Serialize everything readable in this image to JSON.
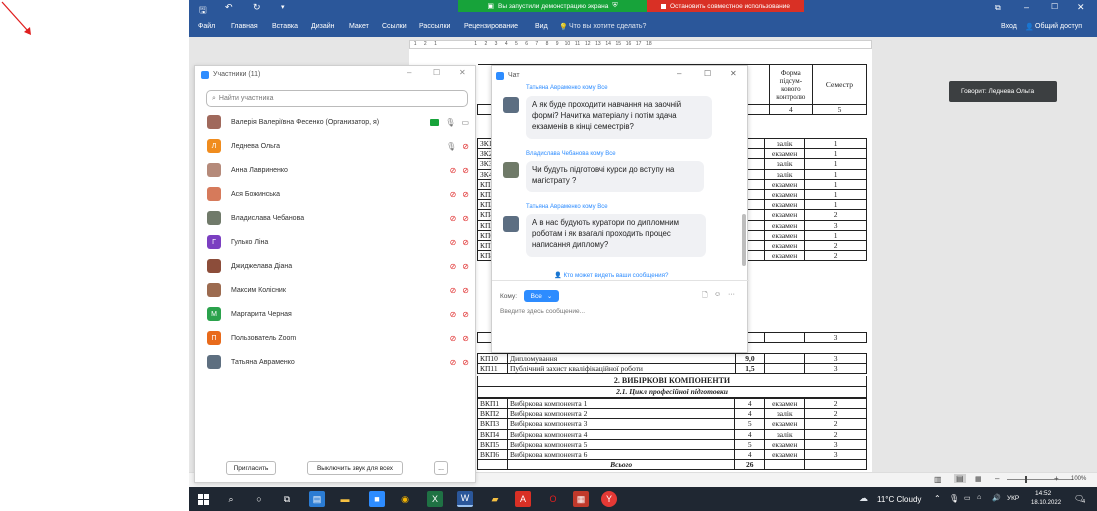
{
  "share_bar": {
    "started_text": "Вы запустили демонстрацию экрана",
    "stop_text": "Остановить совместное использование"
  },
  "word": {
    "menu": [
      "Файл",
      "Главная",
      "Вставка",
      "Дизайн",
      "Макет",
      "Ссылки",
      "Рассылки",
      "Рецензирование",
      "Вид"
    ],
    "tell_me": "Что вы хотите сделать?",
    "login": "Вход",
    "share": "Общий доступ",
    "ruler_marks": [
      "1",
      "2",
      "1",
      "1",
      "2",
      "3",
      "4",
      "5",
      "6",
      "7",
      "8",
      "9",
      "10",
      "11",
      "12",
      "13",
      "14",
      "15",
      "16",
      "17",
      "18"
    ],
    "status_zoom": "100%"
  },
  "tooltip": {
    "speaker": "Говорит: Леднева Ольга"
  },
  "participants": {
    "title": "Участники (11)",
    "search_placeholder": "Найти участника",
    "list": [
      {
        "name": "Валерія Валеріївна Фесенко (Организатор, я)",
        "avatar": "",
        "color": "#a0695c",
        "host": true
      },
      {
        "name": "Леднева Ольга",
        "avatar": "Л",
        "color": "#f08c1e"
      },
      {
        "name": "Анна Лавриненко",
        "avatar": "",
        "color": "#b58a7a"
      },
      {
        "name": "Ася Божинська",
        "avatar": "",
        "color": "#d67a5b"
      },
      {
        "name": "Владислава Чебанова",
        "avatar": "",
        "color": "#707a6a"
      },
      {
        "name": "Гулько Ліна",
        "avatar": "Г",
        "color": "#7b3fc1"
      },
      {
        "name": "Джиджелава Діана",
        "avatar": "",
        "color": "#8c4d3a"
      },
      {
        "name": "Максим Колісник",
        "avatar": "",
        "color": "#9c6b50"
      },
      {
        "name": "Маргарита Черная",
        "avatar": "М",
        "color": "#2ba24c"
      },
      {
        "name": "Пользователь Zoom",
        "avatar": "П",
        "color": "#e86a1b"
      },
      {
        "name": "Татьяна Авраменко",
        "avatar": "",
        "color": "#5e6f80"
      }
    ],
    "invite": "Пригласить",
    "mute_all": "Выключить звук для всех",
    "more": "..."
  },
  "chat": {
    "title": "Чат",
    "messages": [
      {
        "sender": "Татьяна Авраменко кому Все",
        "lines": [
          "А як буде проходити навчання на заочній",
          "формі? Начитка матеріалу і потім  здача",
          "екзаменів в кінці семестрів?"
        ]
      },
      {
        "sender": "Владислава Чебанова кому Все",
        "lines": [
          "Чи будуть підготовчі курси до вступу на",
          "магістрату ?"
        ]
      },
      {
        "sender": "Татьяна Авраменко кому Все",
        "lines": [
          "А в нас будують куратори по дипломним",
          "роботам і як взагалі проходить процес",
          "написання диплому?"
        ]
      }
    ],
    "who_can_see": "Кто может видеть ваши сообщения?",
    "to_label": "Кому:",
    "to_value": "Все",
    "input_placeholder": "Введите здесь сообщение..."
  },
  "doc": {
    "header": {
      "form": "Форма підсум-кового контролю",
      "semester": "Семестр",
      "num4": "4",
      "num5": "5",
      "num1": "1"
    },
    "rows_upper": [
      {
        "code": "ЗК1",
        "form": "залік",
        "sem": "1"
      },
      {
        "code": "ЗК2",
        "form": "екзамен",
        "sem": "1"
      },
      {
        "code": "ЗК3",
        "form": "залік",
        "sem": "1"
      },
      {
        "code": "ЗК4",
        "form": "залік",
        "sem": "1"
      },
      {
        "code": "КП1",
        "form": "екзамен",
        "sem": "1"
      },
      {
        "code": "КП2",
        "form": "екзамен",
        "sem": "1"
      },
      {
        "code": "КП3",
        "form": "екзамен",
        "sem": "1"
      },
      {
        "code": "КП4",
        "form": "екзамен",
        "sem": "2"
      },
      {
        "code": "КП5",
        "form": "екзамен",
        "sem": "3"
      },
      {
        "code": "КП6",
        "form": "екзамен",
        "sem": "1"
      },
      {
        "code": "КП7",
        "form": "екзамен",
        "sem": "2"
      },
      {
        "code": "КП8",
        "form": "екзамен",
        "sem": "2"
      }
    ],
    "block_sem": "3",
    "diploma": [
      {
        "code": "КП10",
        "name": "Дипломування",
        "credits": "9,0",
        "sem": "3"
      },
      {
        "code": "КП11",
        "name": "Публічний захист кваліфікаційної роботи",
        "credits": "1,5",
        "sem": "3"
      }
    ],
    "section_title": "2.  ВИБІРКОВІ КОМПОНЕНТИ",
    "subsection_title": "2.1. Цикл професійної підготовки",
    "elective": [
      {
        "code": "ВКП1",
        "name": "Вибіркова компонента 1",
        "credits": "4",
        "form": "екзамен",
        "sem": "2"
      },
      {
        "code": "ВКП2",
        "name": "Вибіркова компонента 2",
        "credits": "4",
        "form": "залік",
        "sem": "2"
      },
      {
        "code": "ВКП3",
        "name": "Вибіркова компонента 3",
        "credits": "5",
        "form": "екзамен",
        "sem": "2"
      },
      {
        "code": "ВКП4",
        "name": "Вибіркова компонента 4",
        "credits": "4",
        "form": "залік",
        "sem": "2"
      },
      {
        "code": "ВКП5",
        "name": "Вибіркова компонента 5",
        "credits": "5",
        "form": "екзамен",
        "sem": "3"
      },
      {
        "code": "ВКП6",
        "name": "Вибіркова компонента 6",
        "credits": "4",
        "form": "екзамен",
        "sem": "3"
      }
    ],
    "total_label": "Всього",
    "total_value": "26"
  },
  "taskbar": {
    "weather": "11°C  Cloudy",
    "lang": "УКР",
    "time": "14:52",
    "date": "18.10.2022",
    "notif": "4"
  }
}
